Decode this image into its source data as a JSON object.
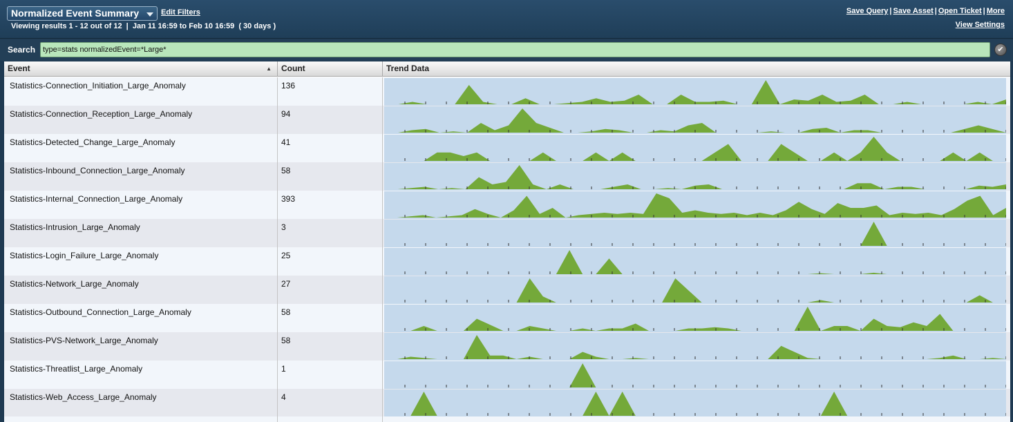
{
  "header": {
    "title": "Normalized Event Summary",
    "edit_filters": "Edit Filters",
    "results_info": "Viewing results 1 - 12 out of 12  |  Jan 11 16:59 to Feb 10 16:59  ( 30 days )",
    "actions": {
      "save_query": "Save Query",
      "save_asset": "Save Asset",
      "open_ticket": "Open Ticket",
      "more": "More",
      "separator": "|"
    },
    "view_settings": "View Settings"
  },
  "search": {
    "label": "Search",
    "value": "type=stats normalizedEvent=*Large*"
  },
  "table": {
    "columns": {
      "event": "Event",
      "count": "Count",
      "trend": "Trend Data"
    },
    "sort_indicator": "▲",
    "colors": {
      "trend_bg": "#c5d9ec",
      "trend_fill": "#74a93a",
      "tick": "#333333"
    },
    "tick_count": 31,
    "rows": [
      {
        "event": "Statistics-Connection_Initiation_Large_Anomaly",
        "count": "136",
        "trend": [
          0,
          0,
          0.1,
          0,
          0,
          0,
          0.8,
          0.1,
          0,
          0,
          0.25,
          0,
          0,
          0.05,
          0.1,
          0.25,
          0.1,
          0.15,
          0.4,
          0,
          0,
          0.4,
          0.1,
          0.1,
          0.15,
          0,
          0,
          1,
          0,
          0.2,
          0.15,
          0.4,
          0.1,
          0.15,
          0.4,
          0,
          0,
          0.1,
          0,
          0,
          0,
          0,
          0.1,
          0,
          0.2
        ]
      },
      {
        "event": "Statistics-Connection_Reception_Large_Anomaly",
        "count": "94",
        "trend": [
          0,
          0,
          0.1,
          0.15,
          0,
          0.05,
          0,
          0.4,
          0.1,
          0.3,
          1,
          0.4,
          0.2,
          0,
          0,
          0.05,
          0.15,
          0.1,
          0,
          0,
          0.1,
          0.05,
          0.3,
          0.4,
          0,
          0,
          0,
          0,
          0.05,
          0,
          0,
          0.15,
          0.2,
          0,
          0.1,
          0.1,
          0,
          0,
          0,
          0,
          0,
          0,
          0.15,
          0.3,
          0.15,
          0
        ]
      },
      {
        "event": "Statistics-Detected_Change_Large_Anomaly",
        "count": "41",
        "trend": [
          0,
          0,
          0,
          0,
          0.35,
          0.35,
          0.2,
          0.35,
          0,
          0,
          0,
          0,
          0.35,
          0,
          0,
          0,
          0.35,
          0,
          0.35,
          0,
          0,
          0,
          0,
          0,
          0,
          0.35,
          0.7,
          0,
          0,
          0,
          0.7,
          0.35,
          0,
          0,
          0.35,
          0,
          0.35,
          1,
          0.35,
          0,
          0,
          0,
          0,
          0.35,
          0,
          0.35,
          0,
          0
        ]
      },
      {
        "event": "Statistics-Inbound_Connection_Large_Anomaly",
        "count": "58",
        "trend": [
          0,
          0,
          0.05,
          0.1,
          0,
          0.05,
          0,
          0.5,
          0.2,
          0.3,
          1,
          0.2,
          0,
          0.2,
          0,
          0,
          0,
          0.1,
          0.2,
          0,
          0,
          0.05,
          0,
          0.15,
          0.2,
          0,
          0,
          0,
          0,
          0,
          0,
          0,
          0,
          0,
          0,
          0.25,
          0.25,
          0,
          0.1,
          0.1,
          0,
          0,
          0,
          0,
          0.15,
          0.1,
          0.2
        ]
      },
      {
        "event": "Statistics-Internal_Connection_Large_Anomaly",
        "count": "393",
        "trend": [
          0,
          0,
          0.05,
          0.1,
          0,
          0.05,
          0.1,
          0.35,
          0.15,
          0,
          0.3,
          0.9,
          0.15,
          0.4,
          0,
          0.1,
          0.15,
          0.2,
          0.15,
          0.2,
          0.15,
          1,
          0.8,
          0.2,
          0.3,
          0.2,
          0.15,
          0.2,
          0.1,
          0.2,
          0.1,
          0.3,
          0.65,
          0.35,
          0.15,
          0.6,
          0.4,
          0.4,
          0.5,
          0.1,
          0.2,
          0.15,
          0.2,
          0.1,
          0.35,
          0.7,
          0.9,
          0.1,
          0.4
        ]
      },
      {
        "event": "Statistics-Intrusion_Large_Anomaly",
        "count": "3",
        "trend": [
          0,
          0,
          0,
          0,
          0,
          0,
          0,
          0,
          0,
          0,
          0,
          0,
          0,
          0,
          0,
          0,
          0,
          0,
          0,
          0,
          0,
          0,
          0,
          0,
          0,
          0,
          0,
          0,
          0,
          0,
          0,
          0,
          0,
          0,
          0,
          0,
          0,
          1,
          0,
          0,
          0,
          0,
          0,
          0,
          0,
          0,
          0,
          0
        ]
      },
      {
        "event": "Statistics-Login_Failure_Large_Anomaly",
        "count": "25",
        "trend": [
          0,
          0,
          0,
          0,
          0,
          0,
          0,
          0,
          0,
          0,
          0,
          0,
          0,
          0,
          1,
          0,
          0,
          0.65,
          0,
          0,
          0,
          0,
          0,
          0,
          0,
          0,
          0,
          0,
          0,
          0,
          0,
          0,
          0,
          0.04,
          0,
          0,
          0,
          0.06,
          0,
          0,
          0,
          0,
          0,
          0,
          0,
          0,
          0,
          0
        ]
      },
      {
        "event": "Statistics-Network_Large_Anomaly",
        "count": "27",
        "trend": [
          0,
          0,
          0,
          0,
          0,
          0,
          0,
          0,
          0,
          0,
          0,
          1,
          0.25,
          0,
          0,
          0,
          0,
          0,
          0,
          0,
          0,
          0,
          1,
          0.5,
          0,
          0,
          0,
          0,
          0,
          0,
          0,
          0,
          0,
          0.1,
          0,
          0,
          0,
          0,
          0,
          0,
          0,
          0,
          0,
          0,
          0,
          0.3,
          0,
          0
        ]
      },
      {
        "event": "Statistics-Outbound_Connection_Large_Anomaly",
        "count": "58",
        "trend": [
          0,
          0,
          0,
          0.2,
          0,
          0,
          0,
          0.5,
          0.25,
          0,
          0,
          0.2,
          0.1,
          0,
          0,
          0.1,
          0,
          0.1,
          0.1,
          0.3,
          0,
          0,
          0,
          0.1,
          0.1,
          0.15,
          0.1,
          0,
          0,
          0,
          0,
          0,
          1,
          0,
          0.2,
          0.2,
          0,
          0.5,
          0.2,
          0.15,
          0.35,
          0.2,
          0.7,
          0,
          0,
          0,
          0,
          0
        ]
      },
      {
        "event": "Statistics-PVS-Network_Large_Anomaly",
        "count": "58",
        "trend": [
          0,
          0,
          0.1,
          0.05,
          0,
          0,
          0,
          1,
          0.15,
          0.15,
          0,
          0.1,
          0,
          0,
          0,
          0.3,
          0.1,
          0,
          0,
          0.05,
          0,
          0,
          0,
          0,
          0,
          0,
          0,
          0,
          0,
          0,
          0.55,
          0.3,
          0.05,
          0,
          0,
          0,
          0,
          0,
          0,
          0,
          0,
          0,
          0.05,
          0.15,
          0,
          0,
          0.05,
          0
        ]
      },
      {
        "event": "Statistics-Threatlist_Large_Anomaly",
        "count": "1",
        "trend": [
          0,
          0,
          0,
          0,
          0,
          0,
          0,
          0,
          0,
          0,
          0,
          0,
          0,
          0,
          0,
          1,
          0,
          0,
          0,
          0,
          0,
          0,
          0,
          0,
          0,
          0,
          0,
          0,
          0,
          0,
          0,
          0,
          0,
          0,
          0,
          0,
          0,
          0,
          0,
          0,
          0,
          0,
          0,
          0,
          0,
          0,
          0,
          0
        ]
      },
      {
        "event": "Statistics-Web_Access_Large_Anomaly",
        "count": "4",
        "trend": [
          0,
          0,
          0,
          1,
          0,
          0,
          0,
          0,
          0,
          0,
          0,
          0,
          0,
          0,
          0,
          0,
          1,
          0,
          1,
          0,
          0,
          0,
          0,
          0,
          0,
          0,
          0,
          0,
          0,
          0,
          0,
          0,
          0,
          0,
          1,
          0,
          0,
          0,
          0,
          0,
          0,
          0,
          0,
          0,
          0,
          0,
          0,
          0
        ]
      }
    ]
  }
}
